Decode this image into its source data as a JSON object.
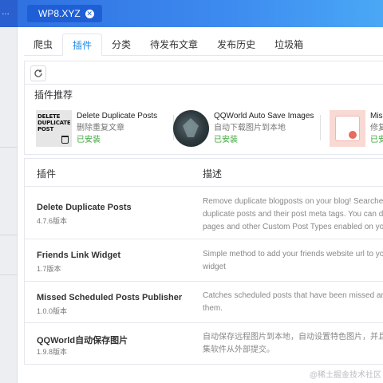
{
  "browser_tab": {
    "title": "WP8.XYZ"
  },
  "nav": {
    "tabs": [
      {
        "label": "爬虫"
      },
      {
        "label": "插件"
      },
      {
        "label": "分类"
      },
      {
        "label": "待发布文章"
      },
      {
        "label": "发布历史"
      },
      {
        "label": "垃圾箱"
      }
    ],
    "active_tab": "插件"
  },
  "recommend": {
    "title": "插件推荐",
    "cards": [
      {
        "name": "Delete Duplicate Posts",
        "desc": "删除重复文章",
        "status": "已安装",
        "thumb_text": "DELETE DUPLICATE POST"
      },
      {
        "name": "QQWorld Auto Save Images",
        "desc": "自动下载图片到本地",
        "status": "已安装"
      },
      {
        "name": "Miss",
        "desc": "修复",
        "status": "已安"
      }
    ]
  },
  "table": {
    "headers": {
      "plugin": "插件",
      "description": "描述"
    },
    "rows": [
      {
        "name": "Delete Duplicate Posts",
        "version": "4.7.6版本",
        "desc_lines": [
          "Remove duplicate blogposts on your blog! Searches",
          "duplicate posts and their post meta tags. You can de",
          "pages and other Custom Post Types enabled on you"
        ]
      },
      {
        "name": "Friends Link Widget",
        "version": "1.7版本",
        "desc_lines": [
          "Simple method to add your friends website url to yo",
          "widget"
        ]
      },
      {
        "name": "Missed Scheduled Posts Publisher",
        "version": "1.0.0版本",
        "desc_lines": [
          "Catches scheduled posts that have been missed and",
          "them."
        ]
      },
      {
        "name": "QQWorld自动保存图片",
        "version": "1.9.8版本",
        "desc_lines": [
          "自动保存远程图片到本地，自动设置特色图片，并且",
          "集软件从外部提交。"
        ]
      }
    ]
  },
  "watermark": "@稀土掘金技术社区",
  "colors": {
    "accent": "#1e88e5",
    "installed": "#3aa63a",
    "topbar": "#3d8bf0"
  }
}
